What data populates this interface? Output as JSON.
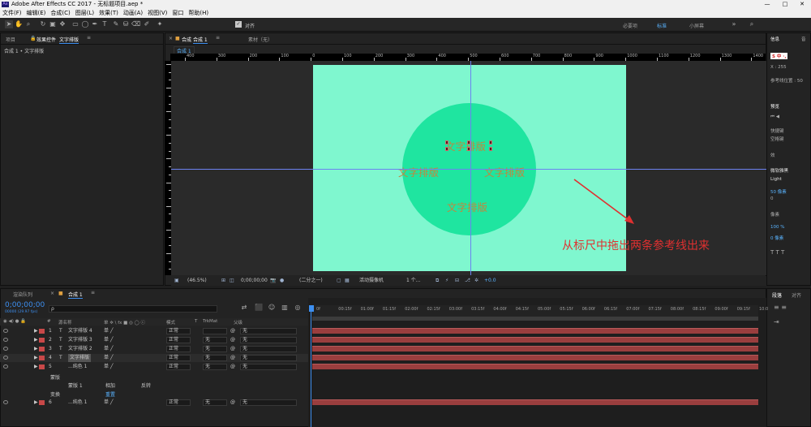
{
  "window": {
    "title": "Adobe After Effects CC 2017 - 无标题项目.aep *",
    "minimize": "—",
    "maximize": "□",
    "close": "✕"
  },
  "menu": [
    "文件(F)",
    "编辑(E)",
    "合成(C)",
    "图层(L)",
    "效果(T)",
    "动画(A)",
    "视图(V)",
    "窗口",
    "帮助(H)"
  ],
  "toolbar": {
    "snap_label": "对齐",
    "workspaces": [
      "必要项",
      "标准",
      "小屏幕"
    ],
    "active_workspace": "标准"
  },
  "project_panel": {
    "tab_project": "项目",
    "tab_effects": "效果控件",
    "effects_target": "文字排版",
    "breadcrumb": "合成 1 • 文字排版"
  },
  "viewer": {
    "tab": "合成",
    "comp_name": "合成 1",
    "footage_tab": "素材（无）",
    "comp_button": "合成 1",
    "ruler_labels": [
      "400",
      "300",
      "200",
      "100",
      "0",
      "100",
      "200",
      "300",
      "400",
      "500",
      "600",
      "700",
      "800",
      "900",
      "1000",
      "1100",
      "1200",
      "1300",
      "1400"
    ],
    "words": [
      "文字排版",
      "文字排版",
      "文字排版",
      "文字排版"
    ],
    "annotation": "从标尺中拖出两条参考线出来",
    "footer": {
      "zoom": "(46.5%)",
      "timecode": "0;00;00;00",
      "resolution": "(二分之一)",
      "camera": "活动摄像机",
      "views": "1 个...",
      "exposure": "+0.0"
    }
  },
  "timeline": {
    "tab_render": "渲染队列",
    "tab_comp": "合成 1",
    "timecode": "0;00;00;00",
    "fps": "00000 (29.97 fps)",
    "search_placeholder": "ρ",
    "columns": {
      "num": "#",
      "name": "源名称",
      "switches": "单 ✲ \\ fx ■ ◎ ◯ ⓒ",
      "mode": "模式",
      "t": "T",
      "trkmat": "TrkMat",
      "parent": "父级"
    },
    "time_labels": [
      "0f",
      "00:15f",
      "01:00f",
      "01:15f",
      "02:00f",
      "02:15f",
      "03:00f",
      "03:15f",
      "04:00f",
      "04:15f",
      "05:00f",
      "05:15f",
      "06:00f",
      "06:15f",
      "07:00f",
      "07:15f",
      "08:00f",
      "08:15f",
      "09:00f",
      "09:15f",
      "10:0"
    ],
    "layers": [
      {
        "num": "1",
        "type": "T",
        "name": "文字排版 4",
        "mode": "正常",
        "trkmat": "",
        "parent": "无",
        "color": "#c84848"
      },
      {
        "num": "2",
        "type": "T",
        "name": "文字排版 3",
        "mode": "正常",
        "trkmat": "无",
        "parent": "无",
        "color": "#c84848"
      },
      {
        "num": "3",
        "type": "T",
        "name": "文字排版 2",
        "mode": "正常",
        "trkmat": "无",
        "parent": "无",
        "color": "#c84848"
      },
      {
        "num": "4",
        "type": "T",
        "name": "文字排版",
        "mode": "正常",
        "trkmat": "无",
        "parent": "无",
        "color": "#c84848"
      },
      {
        "num": "5",
        "type": "",
        "name": "...纯色 1",
        "mode": "正常",
        "trkmat": "无",
        "parent": "无",
        "color": "#c84848"
      },
      {
        "num": "6",
        "type": "",
        "name": "...纯色 1",
        "mode": "正常",
        "trkmat": "无",
        "parent": "无",
        "color": "#c84848"
      }
    ],
    "masks_label": "蒙版",
    "mask1": "蒙版 1",
    "mask_mode": "相加",
    "invert": "反转",
    "transform": "变换",
    "reset": "重置"
  },
  "right_panel": {
    "info": "信息",
    "audio": "音",
    "x_label": "X : 255",
    "guide_pos": "参考线位置 : 50",
    "preview": "预览",
    "shortcut": "快捷键",
    "shortcut_val": "空格键",
    "effects_presets": "效",
    "character_font": "微软雅黑",
    "font_style": "Light",
    "size": "50 像素",
    "tracking": "0",
    "leading": "像素",
    "scale": "100 %",
    "baseline": "0 像素",
    "paragraph_tab": "段落",
    "align_tab": "对齐"
  }
}
